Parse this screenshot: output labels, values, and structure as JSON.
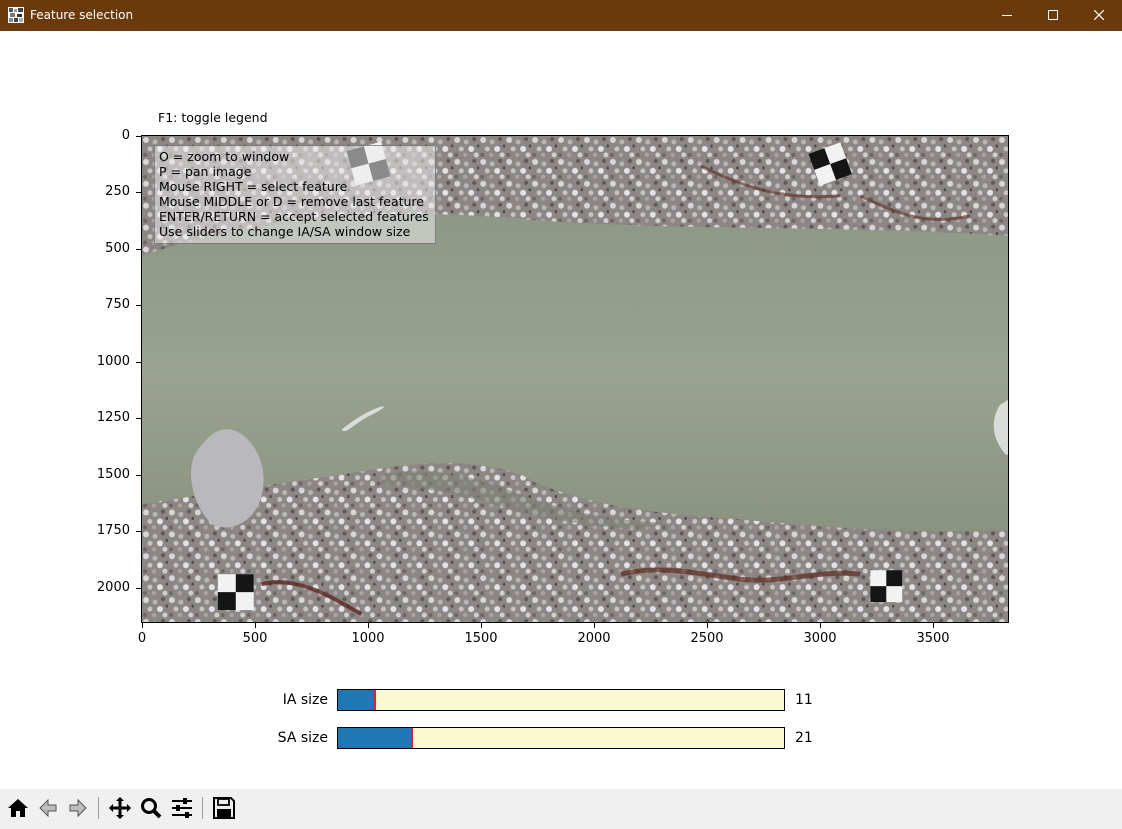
{
  "window": {
    "title": "Feature selection",
    "icons": [
      "app-icon",
      "minimize-icon",
      "maximize-icon",
      "close-icon"
    ]
  },
  "figure": {
    "legend_hint": "F1: toggle legend",
    "legend_lines": [
      "O = zoom to window",
      "P = pan image",
      "Mouse RIGHT = select feature",
      "Mouse MIDDLE or D = remove last feature",
      "ENTER/RETURN = accept selected features",
      "Use sliders to change IA/SA window size"
    ],
    "yticks": [
      "0",
      "250",
      "500",
      "750",
      "1000",
      "1250",
      "1500",
      "1750",
      "2000"
    ],
    "xticks": [
      "0",
      "500",
      "1000",
      "1500",
      "2000",
      "2500",
      "3000",
      "3500"
    ]
  },
  "sliders": [
    {
      "label": "IA size",
      "value": "11",
      "fraction": 0.083
    },
    {
      "label": "SA size",
      "value": "21",
      "fraction": 0.167
    }
  ],
  "toolbar": {
    "buttons": [
      "home-icon",
      "back-icon",
      "forward-icon",
      "pan-icon",
      "zoom-icon",
      "configure-subplots-icon",
      "save-icon"
    ]
  },
  "colors": {
    "titlebar": "#6b3a0c",
    "slider_fill": "#1f77b4",
    "slider_track": "#fafad2",
    "slider_handle": "#d62728",
    "toolbar_bg": "#f0f0f0"
  }
}
